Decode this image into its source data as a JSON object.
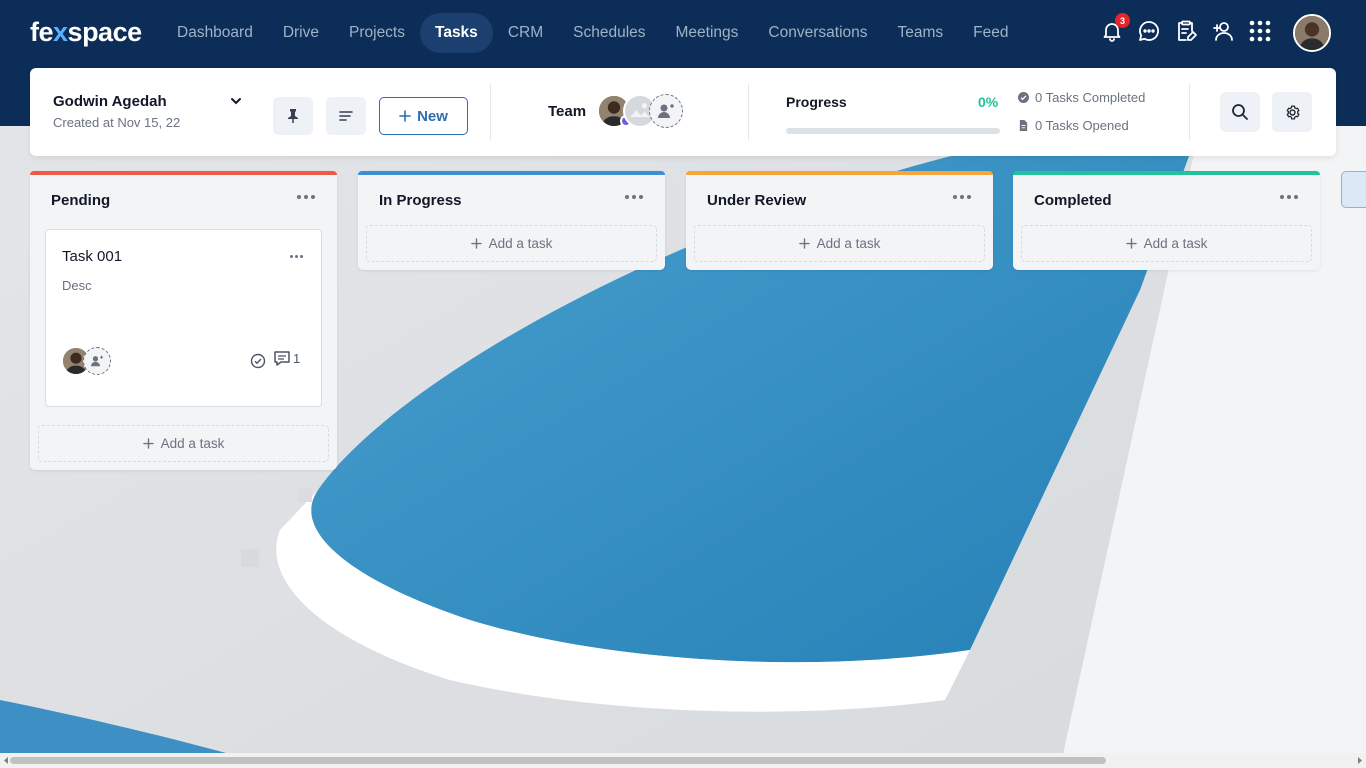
{
  "app": {
    "logo_pre": "fe",
    "logo_x": "x",
    "logo_post": "space"
  },
  "nav": {
    "links": [
      {
        "label": "Dashboard"
      },
      {
        "label": "Drive"
      },
      {
        "label": "Projects"
      },
      {
        "label": "Tasks",
        "active": true
      },
      {
        "label": "CRM"
      },
      {
        "label": "Schedules"
      },
      {
        "label": "Meetings"
      },
      {
        "label": "Conversations"
      },
      {
        "label": "Teams"
      },
      {
        "label": "Feed"
      }
    ],
    "icons": [
      "bell-icon",
      "chat-icon",
      "clipboard-edit-icon",
      "add-user-icon",
      "apps-grid-icon"
    ],
    "notification_count": "3"
  },
  "header": {
    "owner_name": "Godwin Agedah",
    "created": "Created at Nov 15, 22",
    "new_label": "New",
    "team_label": "Team",
    "progress_label": "Progress",
    "progress_pct": "0%",
    "progress_value": 0,
    "tasks_completed": "0 Tasks Completed",
    "tasks_opened": "0 Tasks Opened"
  },
  "board": {
    "columns": [
      {
        "title": "Pending",
        "color": "#f0584a",
        "add_label": "Add a task"
      },
      {
        "title": "In Progress",
        "color": "#3b8fd6",
        "add_label": "Add a task"
      },
      {
        "title": "Under Review",
        "color": "#f6a53b",
        "add_label": "Add a task"
      },
      {
        "title": "Completed",
        "color": "#22c39a",
        "add_label": "Add a task"
      }
    ],
    "task": {
      "title": "Task 001",
      "desc": "Desc",
      "comments": "1"
    }
  },
  "colors": {
    "nav_bg": "#0c2d57",
    "accent": "#2f6db3",
    "success": "#22c39a"
  }
}
